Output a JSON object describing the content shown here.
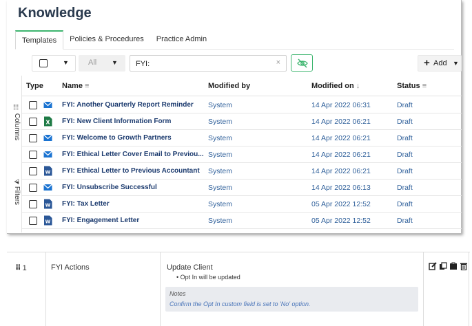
{
  "page": {
    "title": "Knowledge",
    "tabs": [
      {
        "label": "Templates",
        "active": true
      },
      {
        "label": "Policies & Procedures",
        "active": false
      },
      {
        "label": "Practice Admin",
        "active": false
      }
    ]
  },
  "toolbar": {
    "type_filter": "All",
    "search_value": "FYI:",
    "clear_label": "×",
    "add_label": "Add",
    "add_icon": "+",
    "accent_color": "#3cb56e"
  },
  "side_panel": {
    "columns_label": "Columns",
    "filters_label": "Filters"
  },
  "grid": {
    "columns": {
      "type": "Type",
      "name": "Name",
      "modified_by": "Modified by",
      "modified_on": "Modified on",
      "status": "Status"
    },
    "rows": [
      {
        "icon": "mail",
        "name": "FYI: Another Quarterly Report Reminder",
        "modified_by": "System",
        "modified_on": "14 Apr 2022 06:31",
        "status": "Draft"
      },
      {
        "icon": "excel",
        "name": "FYI: New Client Information Form",
        "modified_by": "System",
        "modified_on": "14 Apr 2022 06:21",
        "status": "Draft"
      },
      {
        "icon": "mail",
        "name": "FYI: Welcome to Growth Partners",
        "modified_by": "System",
        "modified_on": "14 Apr 2022 06:21",
        "status": "Draft"
      },
      {
        "icon": "mail",
        "name": "FYI: Ethical Letter Cover Email to Previou...",
        "modified_by": "System",
        "modified_on": "14 Apr 2022 06:21",
        "status": "Draft"
      },
      {
        "icon": "word",
        "name": "FYI: Ethical Letter to Previous Accountant",
        "modified_by": "System",
        "modified_on": "14 Apr 2022 06:21",
        "status": "Draft"
      },
      {
        "icon": "mail",
        "name": "FYI: Unsubscribe Successful",
        "modified_by": "System",
        "modified_on": "14 Apr 2022 06:13",
        "status": "Draft"
      },
      {
        "icon": "word",
        "name": "FYI: Tax Letter",
        "modified_by": "System",
        "modified_on": "05 Apr 2022 12:52",
        "status": "Draft"
      },
      {
        "icon": "word",
        "name": "FYI: Engagement Letter",
        "modified_by": "System",
        "modified_on": "05 Apr 2022 12:52",
        "status": "Draft"
      }
    ]
  },
  "actions": {
    "order": "1",
    "type": "FYI Actions",
    "title": "Update Client",
    "bullet": "Opt In will be updated",
    "notes_heading": "Notes",
    "notes_text": "Confirm the Opt In custom field is set to 'No' option."
  }
}
